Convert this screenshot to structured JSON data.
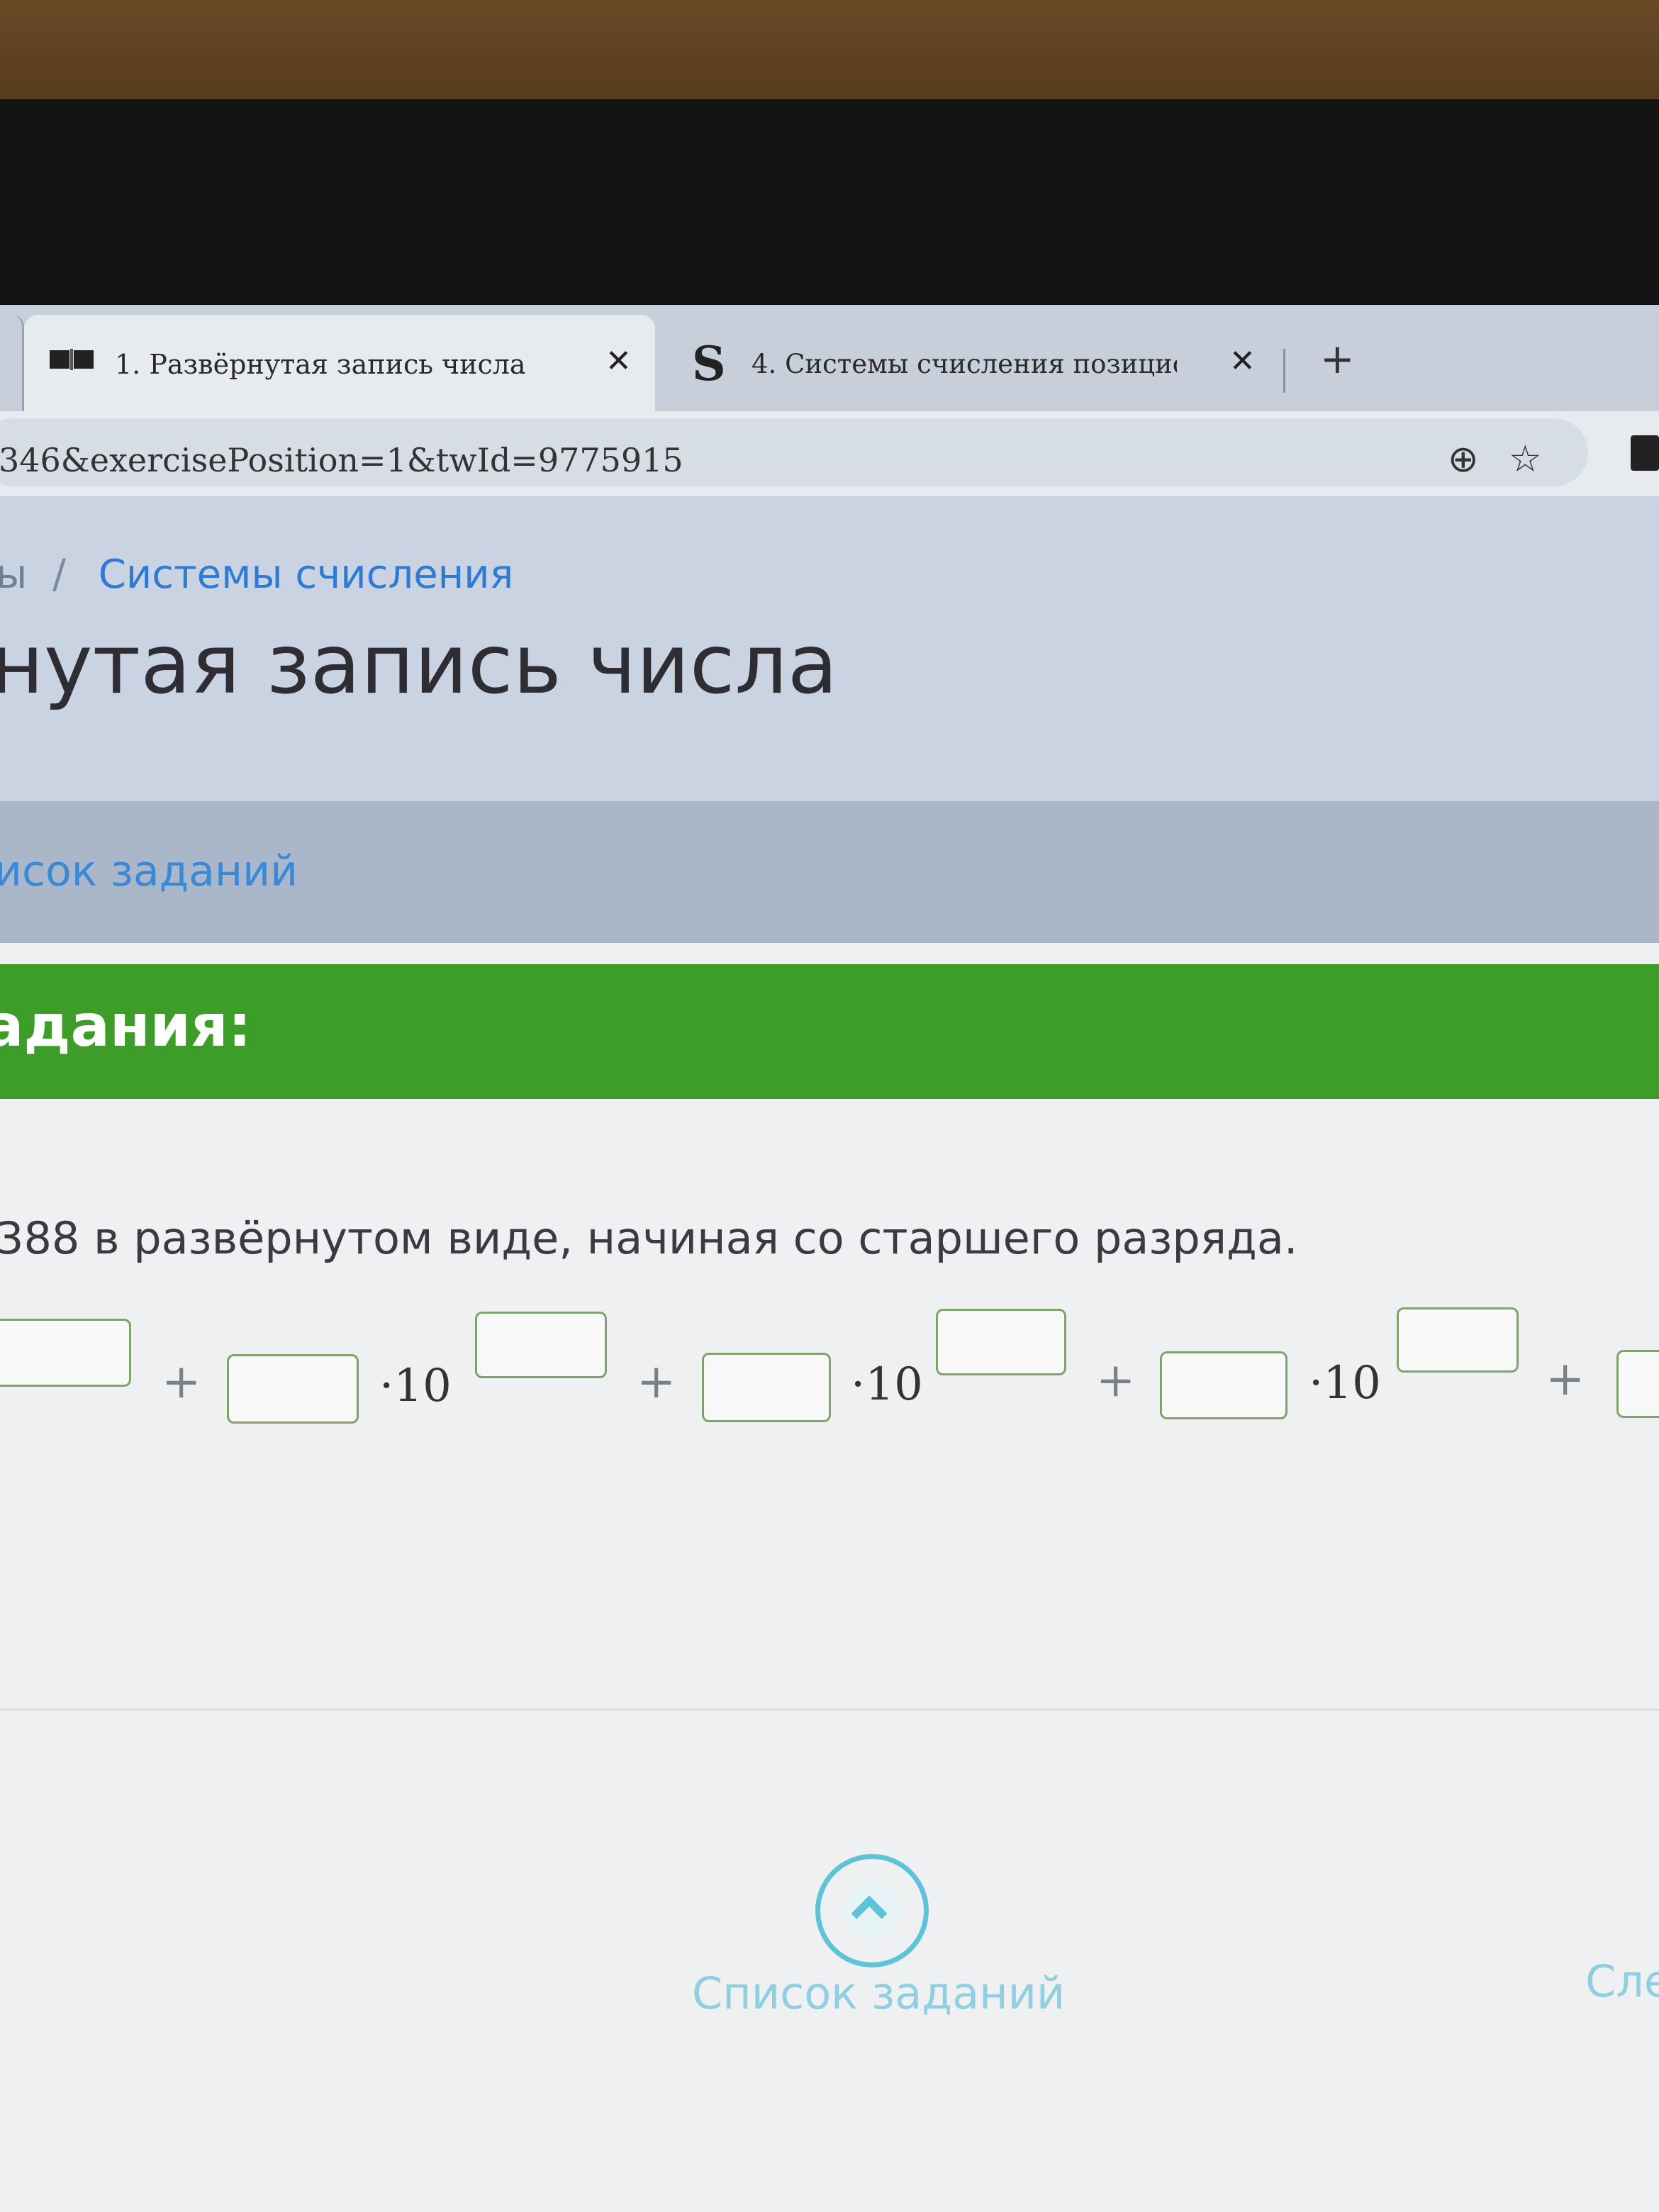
{
  "browser": {
    "tabs": [
      {
        "title": "1. Развёрнутая запись числа",
        "icon": "book-icon",
        "active": true
      },
      {
        "title": "4. Системы счисления позицио",
        "icon": "s-logo-icon",
        "active": false
      }
    ],
    "close_glyph": "✕",
    "new_tab_glyph": "+",
    "url": "346&exercisePosition=1&twId=9775915",
    "icons": {
      "add": "⊕",
      "bookmark": "☆"
    }
  },
  "breadcrumb": {
    "previous": "ы",
    "separator": "/",
    "current": "Системы счисления"
  },
  "page_title": "нутая запись числа",
  "subnav": {
    "task_list_link": "исок заданий"
  },
  "task_band": {
    "label": "адания:"
  },
  "task": {
    "text": "388 в развёрнутом виде, начиная со старшего разряда."
  },
  "equation": {
    "plus": "+",
    "power_base": "·10",
    "terms": [
      {
        "coefficient": "",
        "exponent": ""
      },
      {
        "coefficient": "",
        "exponent": ""
      },
      {
        "coefficient": "",
        "exponent": ""
      },
      {
        "coefficient": "",
        "exponent": ""
      }
    ]
  },
  "bottom_nav": {
    "task_list_label": "Список заданий",
    "next_label": "Сле"
  },
  "colors": {
    "green_band": "#3c9e28",
    "link_blue": "#2f7bd4",
    "input_border": "#7ea36d",
    "up_button": "#5fc3d8"
  }
}
